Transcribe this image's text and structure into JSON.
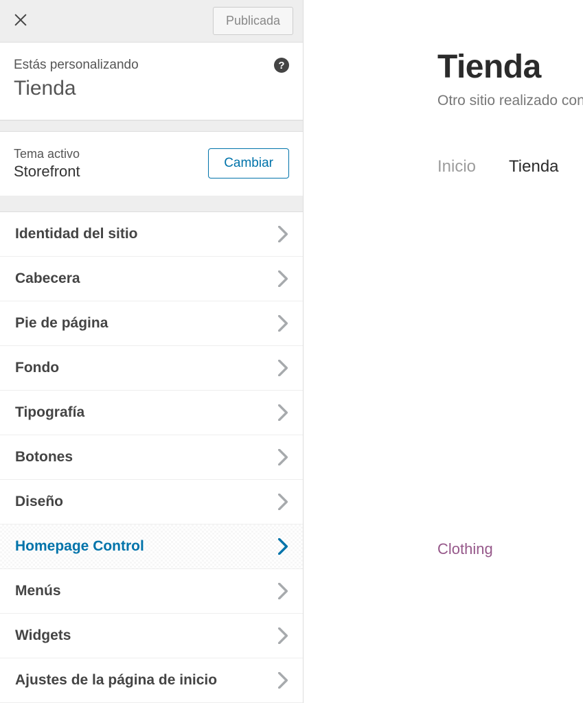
{
  "topbar": {
    "publish_label": "Publicada"
  },
  "header": {
    "customizing_label": "Estás personalizando",
    "site_name": "Tienda",
    "help_glyph": "?"
  },
  "theme": {
    "label": "Tema activo",
    "name": "Storefront",
    "change_label": "Cambiar"
  },
  "menu": [
    {
      "label": "Identidad del sitio",
      "active": false
    },
    {
      "label": "Cabecera",
      "active": false
    },
    {
      "label": "Pie de página",
      "active": false
    },
    {
      "label": "Fondo",
      "active": false
    },
    {
      "label": "Tipografía",
      "active": false
    },
    {
      "label": "Botones",
      "active": false
    },
    {
      "label": "Diseño",
      "active": false
    },
    {
      "label": "Homepage Control",
      "active": true
    },
    {
      "label": "Menús",
      "active": false
    },
    {
      "label": "Widgets",
      "active": false
    },
    {
      "label": "Ajustes de la página de inicio",
      "active": false
    }
  ],
  "preview": {
    "title": "Tienda",
    "tagline": "Otro sitio realizado con W",
    "nav": [
      {
        "label": "Inicio",
        "current": false
      },
      {
        "label": "Tienda",
        "current": true
      }
    ],
    "category_link": "Clothing"
  }
}
